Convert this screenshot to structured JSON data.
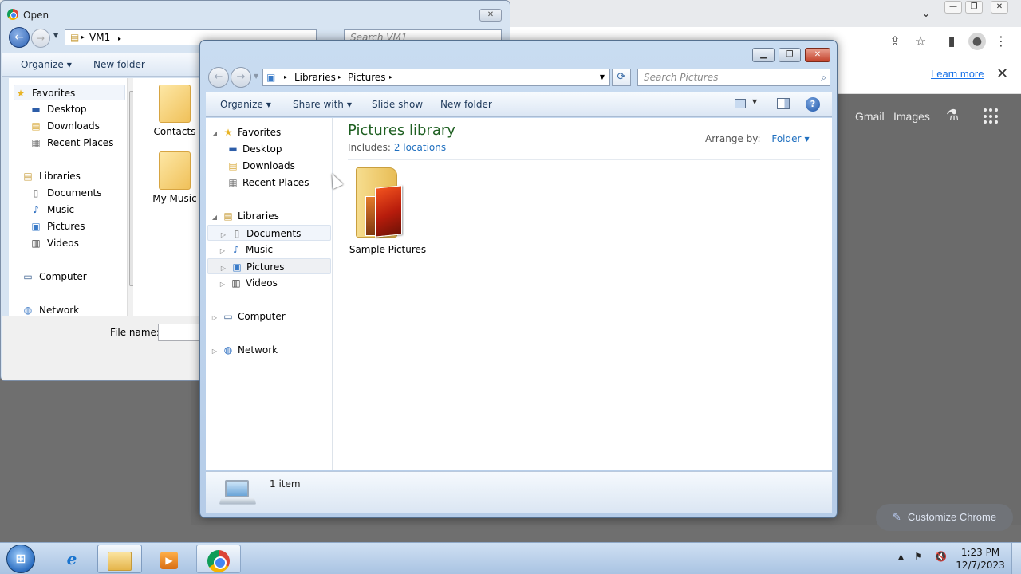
{
  "chrome": {
    "learn_more": "Learn more",
    "ntp_links": [
      "Gmail",
      "Images"
    ],
    "customize_label": "Customize Chrome",
    "window_controls": [
      "—",
      "❐",
      "✕"
    ]
  },
  "open_dialog": {
    "title": "Open",
    "address": "VM1",
    "search_placeholder": "Search VM1",
    "toolbar": {
      "organize": "Organize",
      "new_folder": "New folder"
    },
    "nav": {
      "favorites": "Favorites",
      "desktop": "Desktop",
      "downloads": "Downloads",
      "recent_places": "Recent Places",
      "libraries": "Libraries",
      "documents": "Documents",
      "music": "Music",
      "pictures": "Pictures",
      "videos": "Videos",
      "computer": "Computer",
      "network": "Network"
    },
    "content": [
      {
        "label": "Contacts"
      },
      {
        "label": "My Music"
      }
    ],
    "file_name_label": "File name:"
  },
  "explorer": {
    "address": {
      "segments": [
        "Libraries",
        "Pictures"
      ]
    },
    "search_placeholder": "Search Pictures",
    "toolbar": {
      "organize": "Organize",
      "share_with": "Share with",
      "slide_show": "Slide show",
      "new_folder": "New folder"
    },
    "nav": {
      "favorites": "Favorites",
      "desktop": "Desktop",
      "downloads": "Downloads",
      "recent_places": "Recent Places",
      "libraries": "Libraries",
      "documents": "Documents",
      "music": "Music",
      "pictures": "Pictures",
      "videos": "Videos",
      "computer": "Computer",
      "network": "Network"
    },
    "library_title": "Pictures library",
    "includes_label": "Includes:",
    "includes_link": "2 locations",
    "arrange_label": "Arrange by:",
    "arrange_value": "Folder",
    "items": [
      {
        "label": "Sample Pictures"
      }
    ],
    "status": "1 item"
  },
  "taskbar": {
    "time": "1:23 PM",
    "date": "12/7/2023"
  },
  "icons": {
    "star": "★",
    "back_arrow": "←",
    "forward_arrow": "→",
    "refresh": "⟳",
    "search": "🔍",
    "help": "?"
  },
  "colors": {
    "library_title": "#1e5f21",
    "link": "#1f6fbf",
    "chrome_link": "#1a73e8"
  }
}
